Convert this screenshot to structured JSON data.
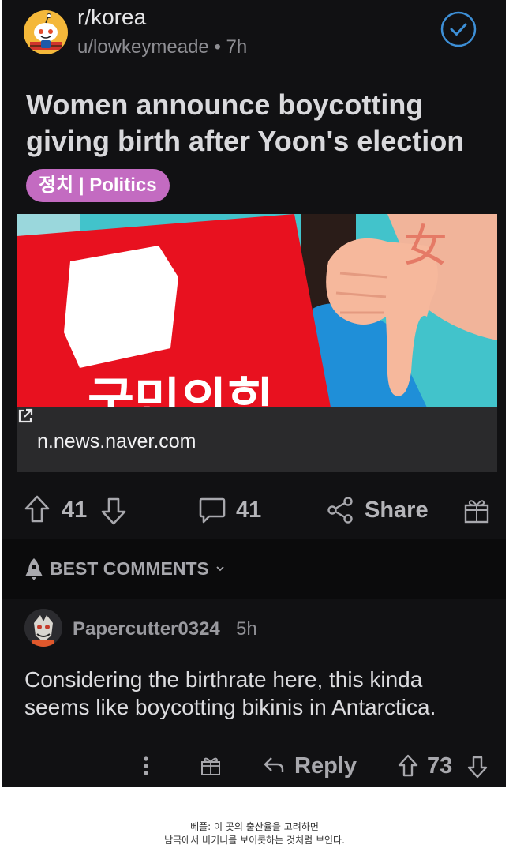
{
  "post": {
    "subreddit": "r/korea",
    "author": "u/lowkeymeade",
    "separator": "•",
    "age": "7h",
    "title": "Women announce boycotting giving birth after Yoon's election",
    "flair": "정치 | Politics",
    "link_domain": "n.news.naver.com",
    "image_text": "국민의힘",
    "hand_char": "女"
  },
  "actions": {
    "score": "41",
    "comments": "41",
    "share_label": "Share"
  },
  "best_comments_label": "BEST COMMENTS",
  "comment": {
    "username": "Papercutter0324",
    "age": "5h",
    "body": "Considering the birthrate here, this kinda seems like boycotting bikinis in Antarctica.",
    "reply_label": "Reply",
    "score": "73"
  },
  "caption": {
    "line1": "베플: 이 곳의 출산율을 고려하면",
    "line2": "남극에서 비키니를 보이콧하는 것처럼 보인다."
  },
  "colors": {
    "background": "#111113",
    "flair": "#c36bc1",
    "joined_check": "#3d8fd6",
    "image_red": "#e8111f",
    "image_teal": "#3fc1c9"
  },
  "icons": [
    "subreddit-icon",
    "joined-check-icon",
    "external-link-icon",
    "upvote-icon",
    "downvote-icon",
    "comment-icon",
    "share-icon",
    "award-icon",
    "rocket-icon",
    "chevron-down-icon",
    "more-icon",
    "reply-icon"
  ]
}
